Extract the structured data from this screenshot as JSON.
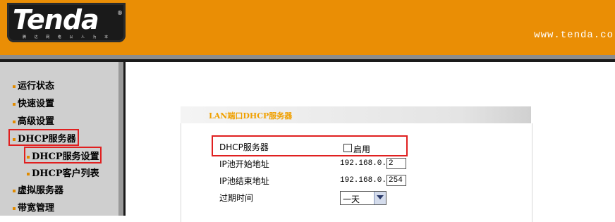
{
  "header": {
    "logo_text": "Tenda",
    "logo_mark": "®",
    "logo_slogan": "腾 达 网 络 以 人 为 本",
    "site_url": "www.tenda.co"
  },
  "sidebar": {
    "items": [
      {
        "label": "运行状态"
      },
      {
        "label": "快速设置"
      },
      {
        "label": "高级设置"
      },
      {
        "label": "DHCP服务器"
      },
      {
        "label": "DHCP服务设置"
      },
      {
        "label": "DHCP客户列表"
      },
      {
        "label": "虚拟服务器"
      },
      {
        "label": "带宽管理"
      }
    ]
  },
  "panel": {
    "title": "LAN端口DHCP服务器",
    "dhcp_label": "DHCP服务器",
    "enable_label": "启用",
    "enable_checked": false,
    "pool_start_label": "IP池开始地址",
    "pool_start_prefix": "192.168.0.",
    "pool_start_value": "2",
    "pool_end_label": "IP池结束地址",
    "pool_end_prefix": "192.168.0.",
    "pool_end_value": "254",
    "lease_label": "过期时间",
    "lease_value": "一天"
  },
  "colors": {
    "header_orange": "#ea8e05",
    "highlight_red": "#e02020",
    "title_orange": "#f0a000"
  }
}
